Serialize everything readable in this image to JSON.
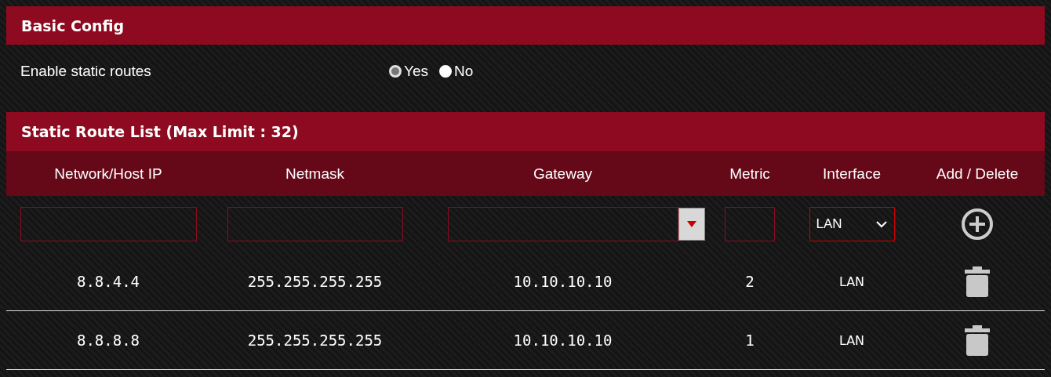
{
  "basic_config": {
    "title": "Basic Config",
    "setting": {
      "label": "Enable static routes",
      "options": [
        {
          "label": "Yes",
          "selected": true
        },
        {
          "label": "No",
          "selected": false
        }
      ]
    }
  },
  "route_list": {
    "title": "Static Route List (Max Limit : 32)",
    "columns": [
      "Network/Host IP",
      "Netmask",
      "Gateway",
      "Metric",
      "Interface",
      "Add / Delete"
    ],
    "new_route": {
      "interface": "LAN"
    },
    "rows": [
      {
        "ip": "8.8.4.4",
        "netmask": "255.255.255.255",
        "gateway": "10.10.10.10",
        "metric": "2",
        "interface": "LAN"
      },
      {
        "ip": "8.8.8.8",
        "netmask": "255.255.255.255",
        "gateway": "10.10.10.10",
        "metric": "1",
        "interface": "LAN"
      }
    ]
  }
}
